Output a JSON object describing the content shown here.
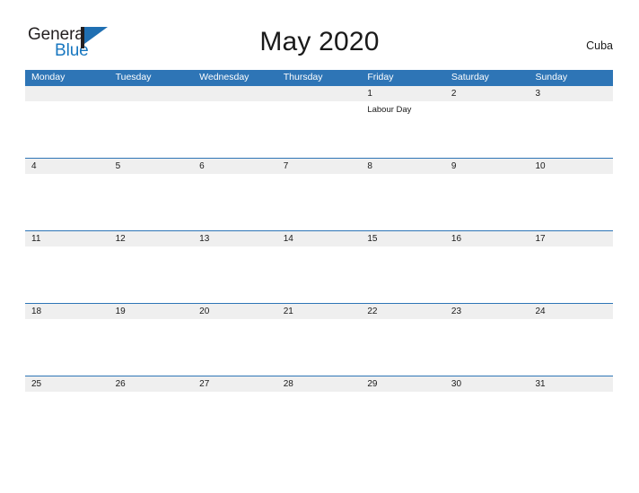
{
  "brand": {
    "word_one": "General",
    "word_two": "Blue",
    "flag_icon": "flag-icon",
    "accent_blue": "#1f6fb2",
    "text_blue": "#1877c0"
  },
  "header": {
    "title": "May 2020",
    "country": "Cuba"
  },
  "theme": {
    "header_blue": "#2e75b6",
    "date_band_gray": "#efefef",
    "rule_blue": "#2e75b6",
    "text_dark": "#1a1a1a",
    "background": "#ffffff"
  },
  "calendar": {
    "day_headers": [
      "Monday",
      "Tuesday",
      "Wednesday",
      "Thursday",
      "Friday",
      "Saturday",
      "Sunday"
    ],
    "weeks": [
      {
        "days": [
          {
            "date": "",
            "event": ""
          },
          {
            "date": "",
            "event": ""
          },
          {
            "date": "",
            "event": ""
          },
          {
            "date": "",
            "event": ""
          },
          {
            "date": "1",
            "event": "Labour Day"
          },
          {
            "date": "2",
            "event": ""
          },
          {
            "date": "3",
            "event": ""
          }
        ]
      },
      {
        "days": [
          {
            "date": "4",
            "event": ""
          },
          {
            "date": "5",
            "event": ""
          },
          {
            "date": "6",
            "event": ""
          },
          {
            "date": "7",
            "event": ""
          },
          {
            "date": "8",
            "event": ""
          },
          {
            "date": "9",
            "event": ""
          },
          {
            "date": "10",
            "event": ""
          }
        ]
      },
      {
        "days": [
          {
            "date": "11",
            "event": ""
          },
          {
            "date": "12",
            "event": ""
          },
          {
            "date": "13",
            "event": ""
          },
          {
            "date": "14",
            "event": ""
          },
          {
            "date": "15",
            "event": ""
          },
          {
            "date": "16",
            "event": ""
          },
          {
            "date": "17",
            "event": ""
          }
        ]
      },
      {
        "days": [
          {
            "date": "18",
            "event": ""
          },
          {
            "date": "19",
            "event": ""
          },
          {
            "date": "20",
            "event": ""
          },
          {
            "date": "21",
            "event": ""
          },
          {
            "date": "22",
            "event": ""
          },
          {
            "date": "23",
            "event": ""
          },
          {
            "date": "24",
            "event": ""
          }
        ]
      },
      {
        "days": [
          {
            "date": "25",
            "event": ""
          },
          {
            "date": "26",
            "event": ""
          },
          {
            "date": "27",
            "event": ""
          },
          {
            "date": "28",
            "event": ""
          },
          {
            "date": "29",
            "event": ""
          },
          {
            "date": "30",
            "event": ""
          },
          {
            "date": "31",
            "event": ""
          }
        ]
      }
    ]
  }
}
